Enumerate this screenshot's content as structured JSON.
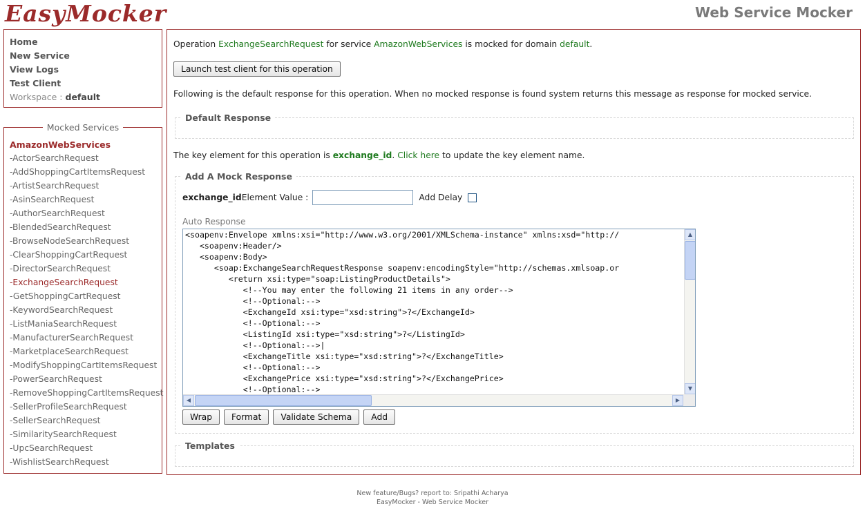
{
  "header": {
    "logo": "EasyMocker",
    "app_title": "Web Service Mocker"
  },
  "nav": {
    "items": [
      "Home",
      "New Service",
      "View Logs",
      "Test Client"
    ],
    "workspace_label": "Workspace :",
    "workspace_value": "default"
  },
  "services": {
    "legend": "Mocked Services",
    "service_name": "AmazonWebServices",
    "operations": [
      "-ActorSearchRequest",
      "-AddShoppingCartItemsRequest",
      "-ArtistSearchRequest",
      "-AsinSearchRequest",
      "-AuthorSearchRequest",
      "-BlendedSearchRequest",
      "-BrowseNodeSearchRequest",
      "-ClearShoppingCartRequest",
      "-DirectorSearchRequest",
      "-ExchangeSearchRequest",
      "-GetShoppingCartRequest",
      "-KeywordSearchRequest",
      "-ListManiaSearchRequest",
      "-ManufacturerSearchRequest",
      "-MarketplaceSearchRequest",
      "-ModifyShoppingCartItemsRequest",
      "-PowerSearchRequest",
      "-RemoveShoppingCartItemsRequest",
      "-SellerProfileSearchRequest",
      "-SellerSearchRequest",
      "-SimilaritySearchRequest",
      "-UpcSearchRequest",
      "-WishlistSearchRequest"
    ],
    "active_index": 9
  },
  "main": {
    "op_prefix": "Operation ",
    "op_name": "ExchangeSearchRequest",
    "op_mid": " for service ",
    "op_service": "AmazonWebServices",
    "op_mid2": " is mocked for domain ",
    "op_domain": "default",
    "op_end": ".",
    "launch_button": "Launch test client for this operation",
    "info_text": "Following is the default response for this operation. When no mocked response is found system returns this message as response for mocked service.",
    "default_response_legend": "Default Response",
    "key_prefix": "The key element for this operation is ",
    "key_name": "exchange_id",
    "key_mid": ". ",
    "key_link": "Click here",
    "key_suffix": " to update the key element name.",
    "add_mock_legend": "Add A Mock Response",
    "element_key": "exchange_id",
    "element_label": " Element Value :",
    "element_value": "",
    "add_delay_label": "Add Delay",
    "add_delay_checked": false,
    "auto_response_label": "Auto Response",
    "code": "<soapenv:Envelope xmlns:xsi=\"http://www.w3.org/2001/XMLSchema-instance\" xmlns:xsd=\"http://\n   <soapenv:Header/>\n   <soapenv:Body>\n      <soap:ExchangeSearchRequestResponse soapenv:encodingStyle=\"http://schemas.xmlsoap.or\n         <return xsi:type=\"soap:ListingProductDetails\">\n            <!--You may enter the following 21 items in any order-->\n            <!--Optional:-->\n            <ExchangeId xsi:type=\"xsd:string\">?</ExchangeId>\n            <!--Optional:-->\n            <ListingId xsi:type=\"xsd:string\">?</ListingId>\n            <!--Optional:-->|\n            <ExchangeTitle xsi:type=\"xsd:string\">?</ExchangeTitle>\n            <!--Optional:-->\n            <ExchangePrice xsi:type=\"xsd:string\">?</ExchangePrice>\n            <!--Optional:-->",
    "buttons": {
      "wrap": "Wrap",
      "format": "Format",
      "validate": "Validate Schema",
      "add": "Add"
    },
    "templates_legend": "Templates"
  },
  "footer": {
    "line1": "New feature/Bugs? report to: Sripathi Acharya",
    "line2": "EasyMocker - Web Service Mocker"
  }
}
